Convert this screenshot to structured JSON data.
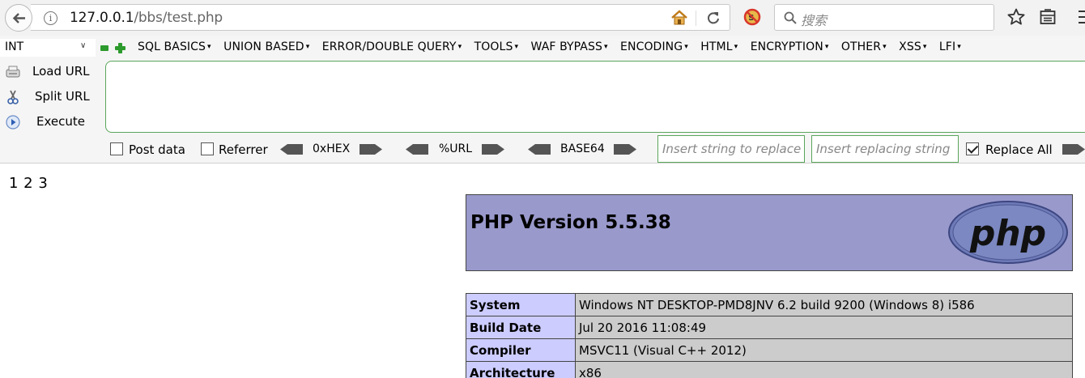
{
  "browser": {
    "url_host": "127.0.0.1",
    "url_path": "/bbs/test.php",
    "search_placeholder": "搜索"
  },
  "hackbar": {
    "select_value": "INT",
    "menus": [
      "SQL BASICS",
      "UNION BASED",
      "ERROR/DOUBLE QUERY",
      "TOOLS",
      "WAF BYPASS",
      "ENCODING",
      "HTML",
      "ENCRYPTION",
      "OTHER",
      "XSS",
      "LFI"
    ],
    "actions": {
      "load_url": "Load URL",
      "split_url": "Split URL",
      "execute": "Execute"
    },
    "post_data_label": "Post data",
    "referrer_label": "Referrer",
    "hex_label": "0xHEX",
    "url_enc_label": "%URL",
    "base64_label": "BASE64",
    "replace_placeholder": "Insert string to replace",
    "replacing_placeholder": "Insert replacing string",
    "replace_all_label": "Replace All",
    "replace_all_checked": true,
    "post_data_checked": false,
    "referrer_checked": false
  },
  "page": {
    "output": "1 2 3",
    "php_title": "PHP Version 5.5.38",
    "logo_text": "php",
    "rows": [
      {
        "key": "System",
        "value": "Windows NT DESKTOP-PMD8JNV 6.2 build 9200 (Windows 8) i586"
      },
      {
        "key": "Build Date",
        "value": "Jul 20 2016 11:08:49"
      },
      {
        "key": "Compiler",
        "value": "MSVC11 (Visual C++ 2012)"
      },
      {
        "key": "Architecture",
        "value": "x86"
      }
    ]
  },
  "colors": {
    "php_header_bg": "#9999cc",
    "table_key_bg": "#ccccff",
    "table_value_bg": "#cccccc",
    "hackbar_green": "#2c9a2c"
  }
}
